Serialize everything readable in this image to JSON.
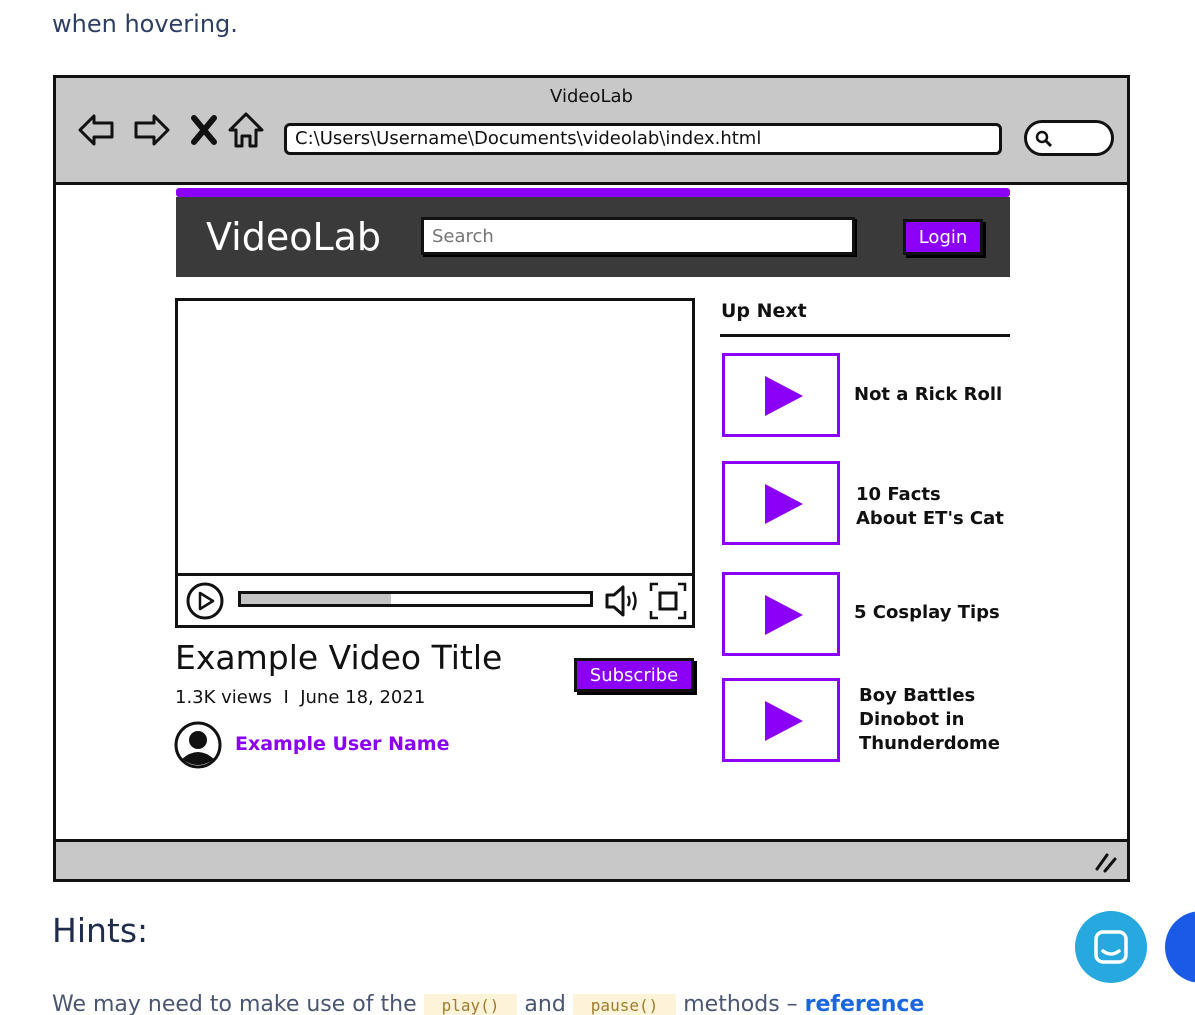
{
  "intro": {
    "text": "when hovering."
  },
  "wireframe": {
    "window_title": "VideoLab",
    "url": "C:\\Users\\Username\\Documents\\videolab\\index.html",
    "nav_icons": [
      "back-arrow-icon",
      "forward-arrow-icon",
      "close-x-icon",
      "home-icon"
    ]
  },
  "app": {
    "logo": "VideoLab",
    "search_placeholder": "Search",
    "login_label": "Login",
    "accent_color": "#8b00f7",
    "header_color": "#3a3a3a"
  },
  "video": {
    "title": "Example Video Title",
    "views": "1.3K views",
    "separator": "I",
    "date": "June 18, 2021",
    "subscribe_label": "Subscribe",
    "user_name": "Example User Name",
    "progress_fraction": 0.43
  },
  "up_next": {
    "heading": "Up Next",
    "items": [
      {
        "title": "Not a Rick Roll"
      },
      {
        "title": "10 Facts About ET's Cat"
      },
      {
        "title": "5 Cosplay Tips"
      },
      {
        "title": "Boy Battles Dinobot in Thunderdome"
      }
    ]
  },
  "hints": {
    "heading": "Hints:",
    "text_start": "We may need to make use of the",
    "code_play": "play()",
    "text_and": "and",
    "code_pause": "pause()",
    "text_methods": "methods –",
    "link": "reference"
  }
}
